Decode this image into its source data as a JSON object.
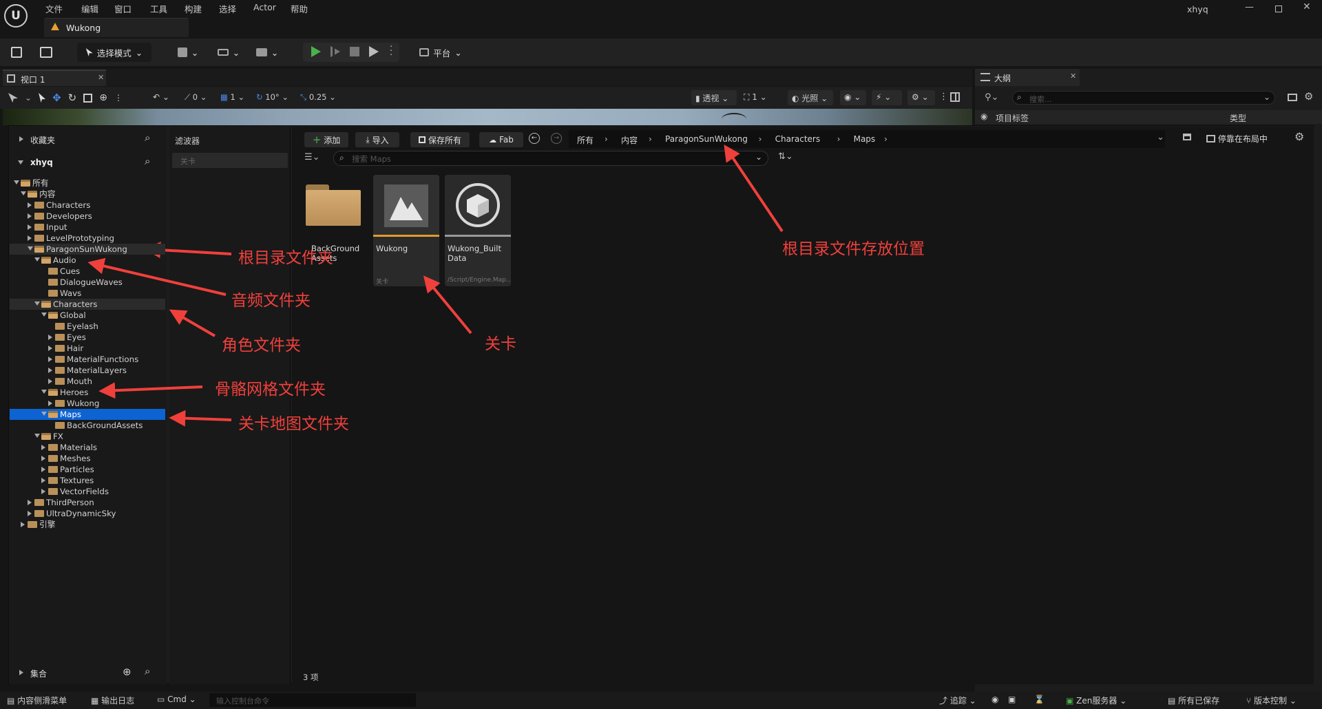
{
  "app": {
    "menu": [
      "文件",
      "编辑",
      "窗口",
      "工具",
      "构建",
      "选择",
      "Actor",
      "帮助"
    ],
    "user": "xhyq",
    "doc_tab": "Wukong"
  },
  "toolbar": {
    "mode_label": "选择模式",
    "platform_label": "平台"
  },
  "viewport": {
    "tab_label": "视口 1",
    "perspective_label": "透视",
    "lighting_label": "光照",
    "rotate_snap": "0",
    "grid_count": "1",
    "angle_snap": "10°",
    "scale_snap": "0.25",
    "camera_count": "1"
  },
  "outline": {
    "tab_label": "大纲",
    "search_placeholder": "搜索...",
    "col_label": "项目标签",
    "col_type": "类型"
  },
  "content_browser": {
    "favorites_label": "收藏夹",
    "root_label": "xhyq",
    "collections_label": "集合",
    "filter_label": "滤波器",
    "filter_item": "关卡",
    "add_label": "添加",
    "import_label": "导入",
    "save_all_label": "保存所有",
    "fab_label": "Fab",
    "breadcrumb": [
      "所有",
      "内容",
      "ParagonSunWukong",
      "Characters",
      "Maps"
    ],
    "dock_label": "停靠在布局中",
    "search_placeholder": "搜索 Maps",
    "item_count": "3 项",
    "tree": [
      {
        "label": "所有",
        "depth": 0,
        "open": true
      },
      {
        "label": "内容",
        "depth": 1,
        "open": true
      },
      {
        "label": "Characters",
        "depth": 2,
        "open": false
      },
      {
        "label": "Developers",
        "depth": 2,
        "open": false
      },
      {
        "label": "Input",
        "depth": 2,
        "open": false
      },
      {
        "label": "LevelPrototyping",
        "depth": 2,
        "open": false
      },
      {
        "label": "ParagonSunWukong",
        "depth": 2,
        "open": true
      },
      {
        "label": "Audio",
        "depth": 3,
        "open": true
      },
      {
        "label": "Cues",
        "depth": 4,
        "leaf": true
      },
      {
        "label": "DialogueWaves",
        "depth": 4,
        "leaf": true
      },
      {
        "label": "Wavs",
        "depth": 4,
        "leaf": true
      },
      {
        "label": "Characters",
        "depth": 3,
        "open": true
      },
      {
        "label": "Global",
        "depth": 4,
        "open": true
      },
      {
        "label": "Eyelash",
        "depth": 5,
        "leaf": true
      },
      {
        "label": "Eyes",
        "depth": 5,
        "open": false
      },
      {
        "label": "Hair",
        "depth": 5,
        "open": false
      },
      {
        "label": "MaterialFunctions",
        "depth": 5,
        "open": false
      },
      {
        "label": "MaterialLayers",
        "depth": 5,
        "open": false
      },
      {
        "label": "Mouth",
        "depth": 5,
        "open": false
      },
      {
        "label": "Heroes",
        "depth": 4,
        "open": true
      },
      {
        "label": "Wukong",
        "depth": 5,
        "open": false
      },
      {
        "label": "Maps",
        "depth": 4,
        "open": true
      },
      {
        "label": "BackGroundAssets",
        "depth": 5,
        "leaf": true
      },
      {
        "label": "FX",
        "depth": 3,
        "open": true
      },
      {
        "label": "Materials",
        "depth": 4,
        "open": false
      },
      {
        "label": "Meshes",
        "depth": 4,
        "open": false
      },
      {
        "label": "Particles",
        "depth": 4,
        "open": false
      },
      {
        "label": "Textures",
        "depth": 4,
        "open": false
      },
      {
        "label": "VectorFields",
        "depth": 4,
        "open": false
      },
      {
        "label": "ThirdPerson",
        "depth": 2,
        "open": false
      },
      {
        "label": "UltraDynamicSky",
        "depth": 2,
        "open": false
      },
      {
        "label": "引擎",
        "depth": 1,
        "open": false
      }
    ],
    "assets": [
      {
        "name": "BackGround Assets",
        "kind": "folder"
      },
      {
        "name": "Wukong",
        "kind": "map",
        "type": "关卡"
      },
      {
        "name": "Wukong_Built Data",
        "kind": "data",
        "type": "/Script/Engine.Map..."
      }
    ]
  },
  "annotations": [
    "根目录文件夹",
    "音频文件夹",
    "角色文件夹",
    "骨骼网格文件夹",
    "关卡地图文件夹",
    "关卡",
    "根目录文件存放位置"
  ],
  "statusbar": {
    "content_drawer": "内容侧滑菜单",
    "output_log": "输出日志",
    "cmd": "Cmd",
    "console_placeholder": "输入控制台命令",
    "trace": "追踪",
    "zen": "Zen服务器",
    "all_saved": "所有已保存",
    "version_control": "版本控制"
  },
  "colors": {
    "accent_blue": "#0d63d2",
    "annotation_red": "#f0403c",
    "play_green": "#4cb04c",
    "folder_tan": "#c9a06a"
  }
}
